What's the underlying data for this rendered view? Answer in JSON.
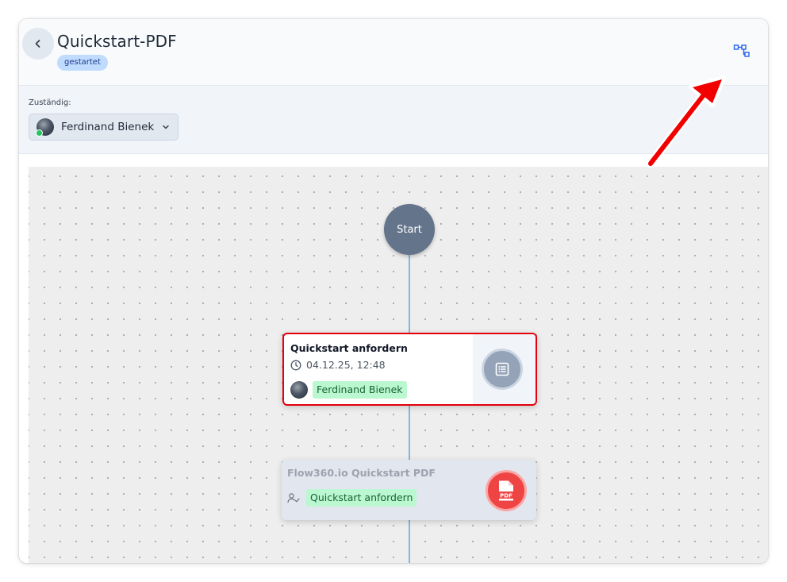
{
  "header": {
    "title": "Quickstart-PDF",
    "status": "gestartet",
    "back_icon": "chevron-left-icon",
    "tree_icon": "workflow-tree-icon"
  },
  "assignee": {
    "label": "Zuständig:",
    "name": "Ferdinand Bienek",
    "online": true
  },
  "flow": {
    "start_label": "Start",
    "nodes": [
      {
        "title": "Quickstart anfordern",
        "time": "04.12.25, 12:48",
        "assignee": "Ferdinand Bienek",
        "icon": "form-list-icon",
        "highlighted": true
      },
      {
        "title": "Flow360.io Quickstart PDF",
        "source_task": "Quickstart anfordern",
        "icon": "pdf-file-icon",
        "highlighted": false
      }
    ]
  },
  "colors": {
    "accent_blue": "#2563eb",
    "status_badge": "#bfdbfe",
    "start_node": "#64748b",
    "connector": "#7fb9e0",
    "chip_green": "#bbf7d0",
    "highlight_red": "#e3000b",
    "pdf_red": "#ef4444"
  }
}
